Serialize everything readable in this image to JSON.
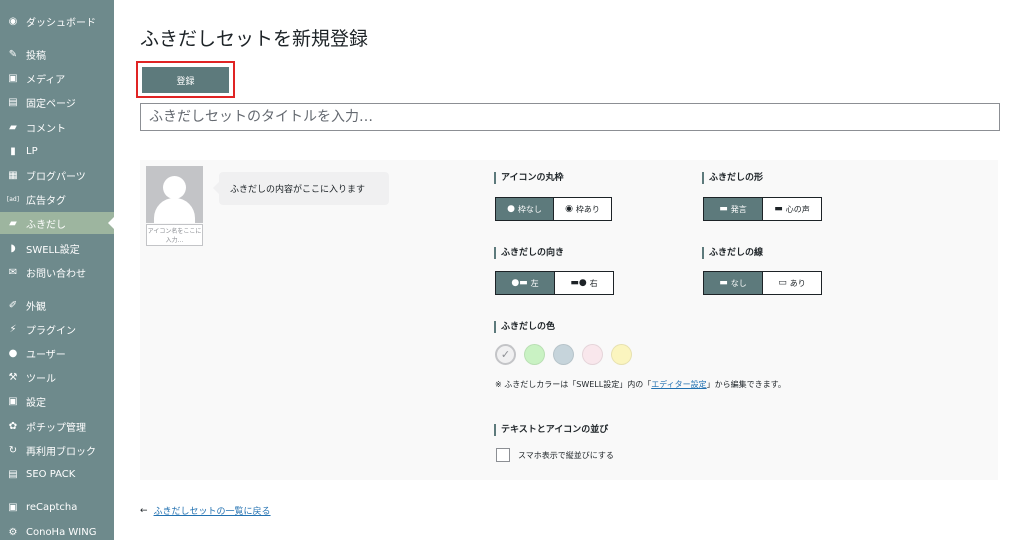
{
  "sidebar": {
    "items": [
      {
        "label": "ダッシュボード",
        "icon": "dashboard-icon",
        "glyph": "◉"
      },
      {
        "label": "投稿",
        "icon": "pin-icon",
        "glyph": "✎"
      },
      {
        "label": "メディア",
        "icon": "media-icon",
        "glyph": "▣"
      },
      {
        "label": "固定ページ",
        "icon": "page-icon",
        "glyph": "▤"
      },
      {
        "label": "コメント",
        "icon": "comment-icon",
        "glyph": "▰"
      },
      {
        "label": "LP",
        "icon": "document-icon",
        "glyph": "▮"
      },
      {
        "label": "ブログパーツ",
        "icon": "grid-icon",
        "glyph": "▦"
      },
      {
        "label": "広告タグ",
        "icon": "ad-icon",
        "glyph": "[ad]"
      },
      {
        "label": "ふきだし",
        "icon": "balloon-icon",
        "glyph": "▰"
      },
      {
        "label": "SWELL設定",
        "icon": "swell-icon",
        "glyph": "◗"
      },
      {
        "label": "お問い合わせ",
        "icon": "mail-icon",
        "glyph": "✉"
      },
      {
        "label": "外観",
        "icon": "brush-icon",
        "glyph": "✐"
      },
      {
        "label": "プラグイン",
        "icon": "plugin-icon",
        "glyph": "⚡"
      },
      {
        "label": "ユーザー",
        "icon": "user-icon",
        "glyph": "●"
      },
      {
        "label": "ツール",
        "icon": "wrench-icon",
        "glyph": "⚒"
      },
      {
        "label": "設定",
        "icon": "settings-icon",
        "glyph": "▣"
      },
      {
        "label": "ポチップ管理",
        "icon": "paw-icon",
        "glyph": "✿"
      },
      {
        "label": "再利用ブロック",
        "icon": "reuse-icon",
        "glyph": "↻"
      },
      {
        "label": "SEO PACK",
        "icon": "seo-icon",
        "glyph": "▤"
      },
      {
        "label": "reCaptcha",
        "icon": "recaptcha-icon",
        "glyph": "▣"
      },
      {
        "label": "ConoHa WING",
        "icon": "gear-icon",
        "glyph": "⚙"
      }
    ],
    "active_index": 8,
    "bg_color": "#6e8a8c",
    "active_color": "#9db59f"
  },
  "main": {
    "title": "ふきだしセットを新規登録",
    "register_label": "登録",
    "title_placeholder": "ふきだしセットのタイトルを入力…",
    "accent_color": "#5d7a7c",
    "highlight_color": "#e02424"
  },
  "preview": {
    "bubble_text": "ふきだしの内容がここに入ります",
    "icon_name_placeholder": "アイコン名をここに入力..."
  },
  "settings": {
    "icon_border": {
      "label": "アイコンの丸枠",
      "options": [
        "枠なし",
        "枠あり"
      ],
      "selected": 0
    },
    "shape": {
      "label": "ふきだしの形",
      "options": [
        "発言",
        "心の声"
      ],
      "selected": 0
    },
    "direction": {
      "label": "ふきだしの向き",
      "options": [
        "左",
        "右"
      ],
      "selected": 0
    },
    "line": {
      "label": "ふきだしの線",
      "options": [
        "なし",
        "あり"
      ],
      "selected": 0
    },
    "color": {
      "label": "ふきだしの色",
      "swatches": [
        {
          "name": "default",
          "hex": "#f0f0f1",
          "selected": true
        },
        {
          "name": "green",
          "hex": "#c9f2c3"
        },
        {
          "name": "blue",
          "hex": "#c6d4db"
        },
        {
          "name": "red",
          "hex": "#f9e7ec"
        },
        {
          "name": "yellow",
          "hex": "#fbf5bf"
        }
      ],
      "note_prefix": "※ ふきだしカラーは「SWELL設定」内の「",
      "note_link": "エディター設定",
      "note_suffix": "」から編集できます。"
    },
    "order": {
      "label": "テキストとアイコンの並び",
      "checkbox_label": "スマホ表示で縦並びにする",
      "checked": false
    }
  },
  "footer": {
    "back_arrow": "←",
    "back_link": "ふきだしセットの一覧に戻る"
  }
}
